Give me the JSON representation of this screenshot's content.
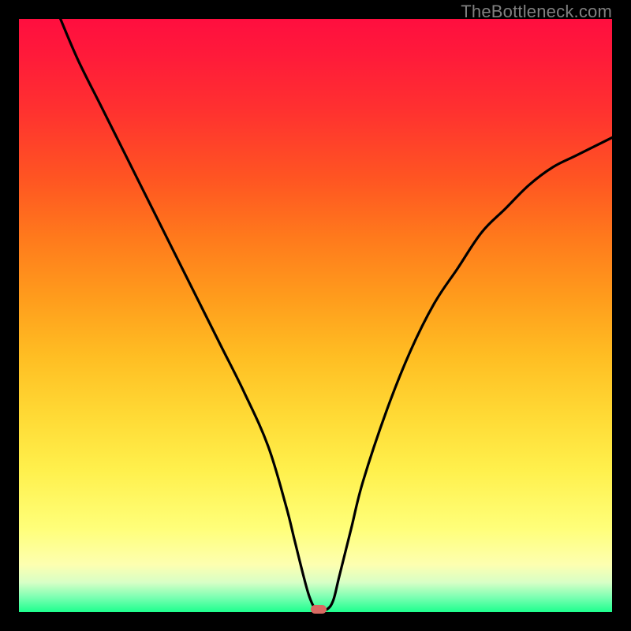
{
  "watermark": "TheBottleneck.com",
  "colors": {
    "frame": "#000000",
    "curve": "#000000",
    "marker": "#d96a62"
  },
  "chart_data": {
    "type": "line",
    "title": "",
    "xlabel": "",
    "ylabel": "",
    "xlim": [
      0,
      100
    ],
    "ylim": [
      0,
      100
    ],
    "grid": false,
    "legend": false,
    "series": [
      {
        "name": "bottleneck-curve",
        "x": [
          7,
          10,
          14,
          18,
          22,
          26,
          30,
          34,
          38,
          42,
          45,
          46.5,
          48,
          49,
          50,
          51,
          52,
          53,
          54,
          56,
          58,
          62,
          66,
          70,
          74,
          78,
          82,
          86,
          90,
          94,
          100
        ],
        "y": [
          100,
          93,
          85,
          77,
          69,
          61,
          53,
          45,
          37,
          28,
          18,
          12,
          6,
          2.5,
          0.5,
          0.5,
          0.5,
          2,
          6,
          14,
          22,
          34,
          44,
          52,
          58,
          64,
          68,
          72,
          75,
          77,
          80
        ]
      }
    ],
    "marker": {
      "x": 50.5,
      "y": 0.5
    },
    "background_gradient": {
      "type": "vertical",
      "stops": [
        {
          "pos": 0,
          "color": "#ff0e3f"
        },
        {
          "pos": 50,
          "color": "#ffb822"
        },
        {
          "pos": 85,
          "color": "#ffff7a"
        },
        {
          "pos": 100,
          "color": "#1eff8e"
        }
      ]
    }
  }
}
